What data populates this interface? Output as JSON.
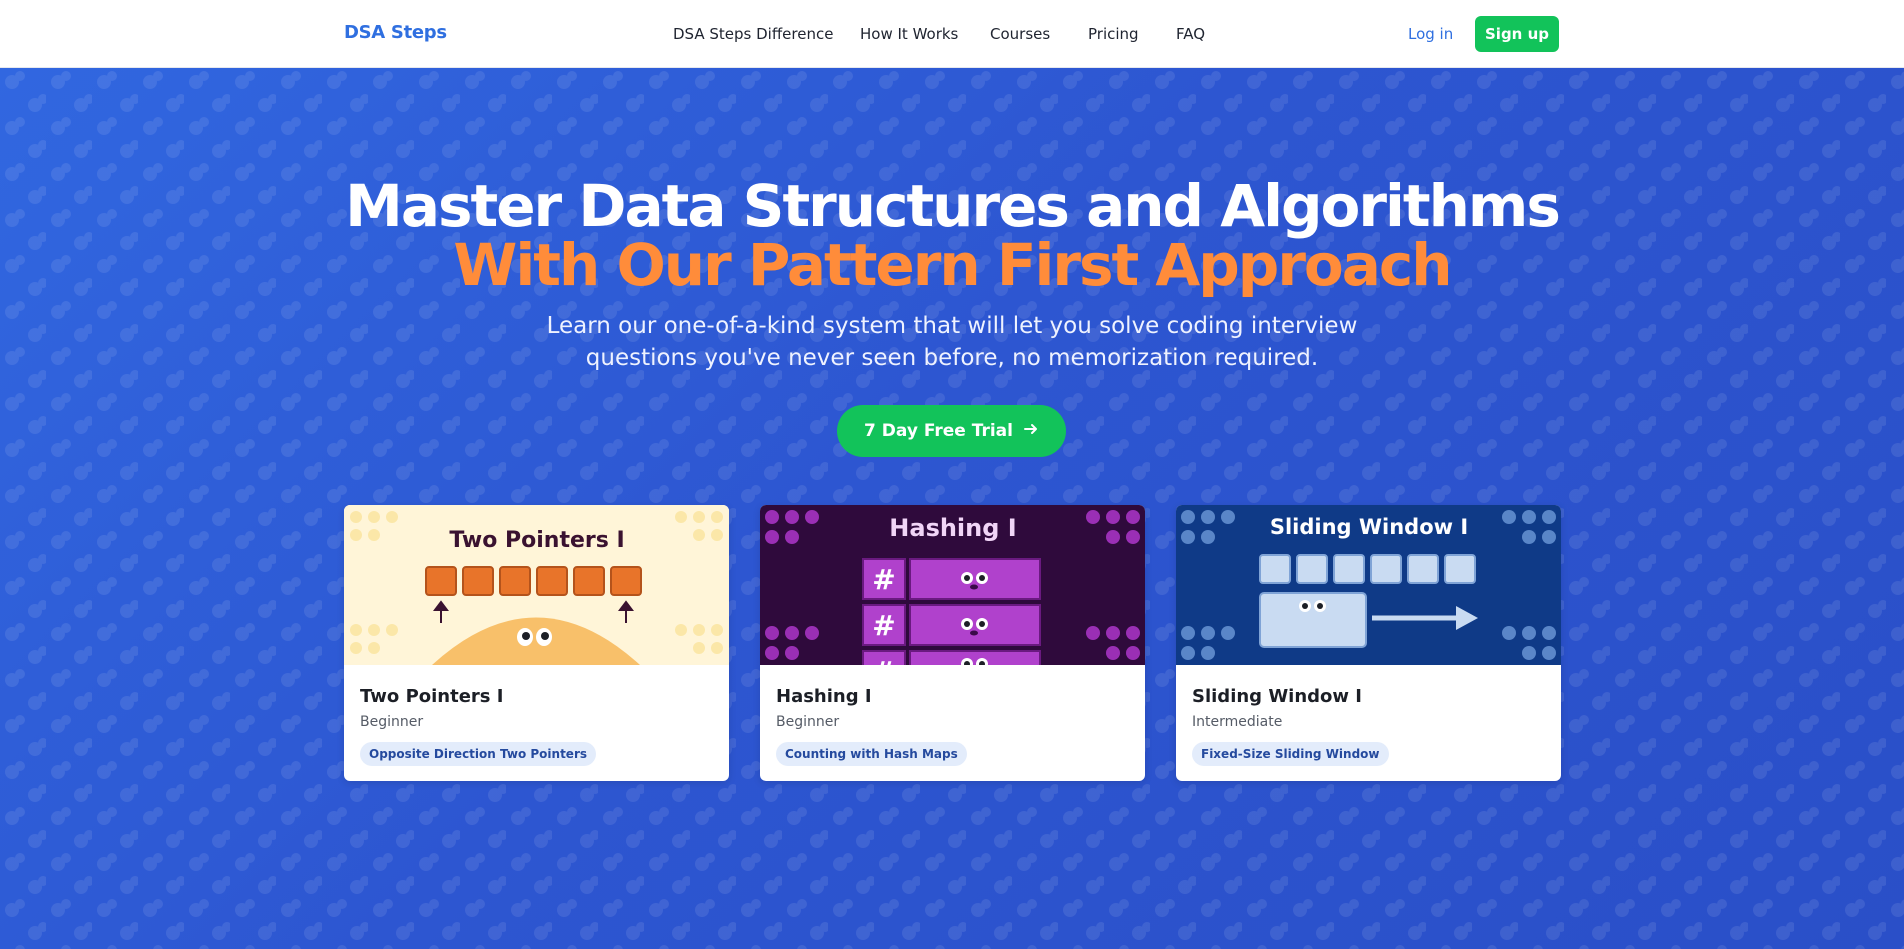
{
  "header": {
    "logo": "DSA Steps",
    "nav": [
      "DSA Steps Difference",
      "How It Works",
      "Courses",
      "Pricing",
      "FAQ"
    ],
    "login_label": "Log in",
    "signup_label": "Sign up"
  },
  "hero": {
    "headline_line1": "Master Data Structures and Algorithms",
    "headline_line2": "With Our Pattern First Approach",
    "subtitle": "Learn our one-of-a-kind system that will let you solve coding interview questions you've never seen before, no memorization required.",
    "cta_label": "7 Day Free Trial",
    "cta_icon": "arrow-right-icon"
  },
  "courses": [
    {
      "thumb_title": "Two Pointers I",
      "title": "Two Pointers I",
      "level": "Beginner",
      "tag": "Opposite Direction Two Pointers"
    },
    {
      "thumb_title": "Hashing I",
      "title": "Hashing I",
      "level": "Beginner",
      "tag": "Counting with Hash Maps"
    },
    {
      "thumb_title": "Sliding Window I",
      "title": "Sliding Window I",
      "level": "Intermediate",
      "tag": "Fixed-Size Sliding Window"
    }
  ],
  "colors": {
    "brand_blue": "#2f6fe0",
    "cta_green": "#12c35a",
    "accent_orange": "#ff8c3a",
    "hero_bg": "#2f5bd6"
  }
}
